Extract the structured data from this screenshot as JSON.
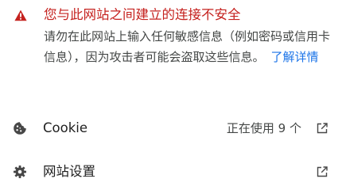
{
  "warning": {
    "title": "您与此网站之间建立的连接不安全",
    "body": "请勿在此网站上输入任何敏感信息（例如密码或信用卡信息），因为攻击者可能会盗取这些信息。",
    "learn_more": "了解详情",
    "icon": "warning-triangle-icon",
    "color": "#c5221f"
  },
  "rows": {
    "cookie": {
      "label": "Cookie",
      "status": "正在使用 9 个",
      "icon": "cookie-icon",
      "action_icon": "open-external-icon"
    },
    "site_settings": {
      "label": "网站设置",
      "icon": "gear-icon",
      "action_icon": "open-external-icon"
    }
  },
  "colors": {
    "link": "#1a73e8",
    "text": "#1f1f1f",
    "secondary_text": "#444746",
    "icon": "#474747"
  }
}
